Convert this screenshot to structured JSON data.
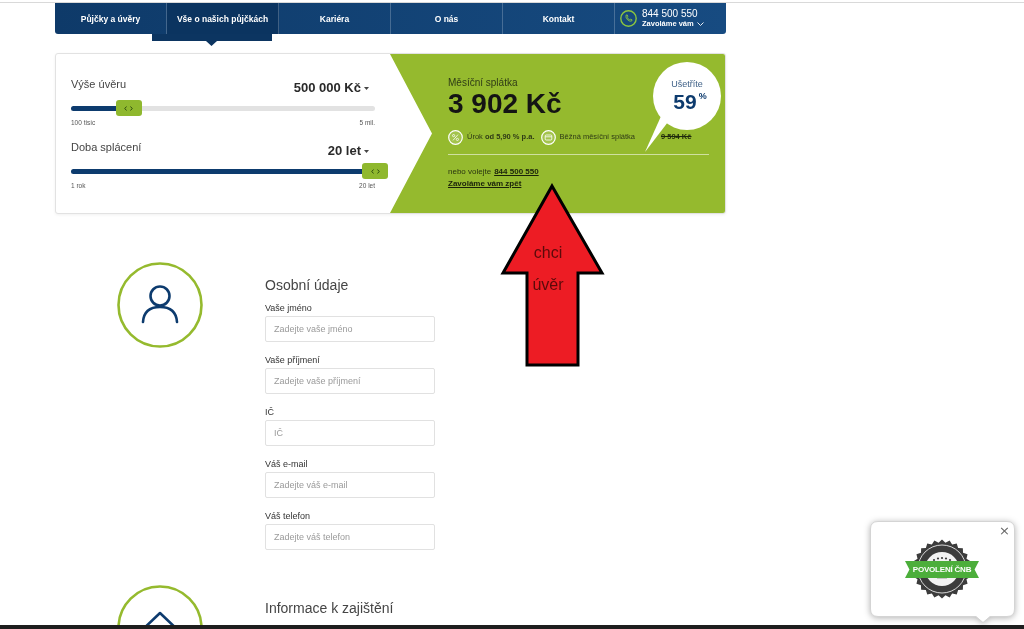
{
  "nav": {
    "items": [
      {
        "label": "Půjčky a úvěry",
        "selected": false
      },
      {
        "label": "Vše o našich půjčkách",
        "selected": true
      },
      {
        "label": "Kariéra",
        "selected": false
      },
      {
        "label": "O nás",
        "selected": false
      },
      {
        "label": "Kontakt",
        "selected": false
      }
    ],
    "phone": {
      "number": "844 500 550",
      "callback": "Zavoláme vám"
    }
  },
  "calculator": {
    "sliders": [
      {
        "label": "Výše úvěru",
        "value": "500 000 Kč",
        "level": 0.19,
        "min": "100 tisíc",
        "max": "5 mil."
      },
      {
        "label": "Doba splácení",
        "value": "20 let",
        "level": 1,
        "min": "1 rok",
        "max": "20 let"
      }
    ],
    "result": {
      "label": "Měsíční splátka",
      "amount": "3 902 Kč",
      "savings": {
        "label": "Ušetříte",
        "value": "59",
        "unit": "%"
      },
      "interest": "Úrok **od 5,90 % p.a.**",
      "regular_label": "Běžná měsíční splátka",
      "regular_value": "9 594 Kč",
      "call_text": "nebo volejte",
      "phone": "844 500 550",
      "callback": "Zavoláme vám zpět"
    }
  },
  "annotation": {
    "lines": [
      "chci",
      "úvěr"
    ]
  },
  "form": {
    "sections": [
      {
        "kind": "personal",
        "title": "Osobní údaje",
        "fields": [
          {
            "label": "Vaše jméno",
            "placeholder": "Zadejte vaše jméno"
          },
          {
            "label": "Vaše příjmení",
            "placeholder": "Zadejte vaše příjmení"
          },
          {
            "label": "IČ",
            "placeholder": "IČ"
          },
          {
            "label": "Váš e-mail",
            "placeholder": "Zadejte váš e-mail"
          },
          {
            "label": "Váš telefon",
            "placeholder": "Zadejte váš telefon"
          }
        ]
      },
      {
        "kind": "collateral",
        "title": "Informace k zajištění"
      }
    ]
  },
  "popup": {
    "badge": "POVOLENÍ ČNB",
    "close": "×"
  }
}
